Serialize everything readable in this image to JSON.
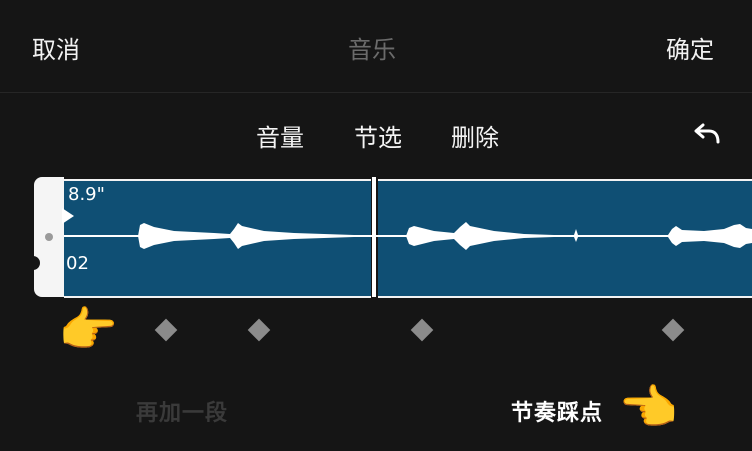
{
  "header": {
    "cancel_label": "取消",
    "title": "音乐",
    "confirm_label": "确定"
  },
  "toolbar": {
    "volume_label": "音量",
    "select_label": "节选",
    "delete_label": "删除",
    "undo_icon": "undo-icon"
  },
  "timeline": {
    "duration_label": "8.9\"",
    "timecode_label": "02",
    "clip_color": "#0f4f74"
  },
  "bottom": {
    "add_segment_label": "再加一段",
    "beat_sync_label": "节奏踩点"
  },
  "decorations": {
    "hand_left": "👉",
    "hand_right": "👉"
  }
}
